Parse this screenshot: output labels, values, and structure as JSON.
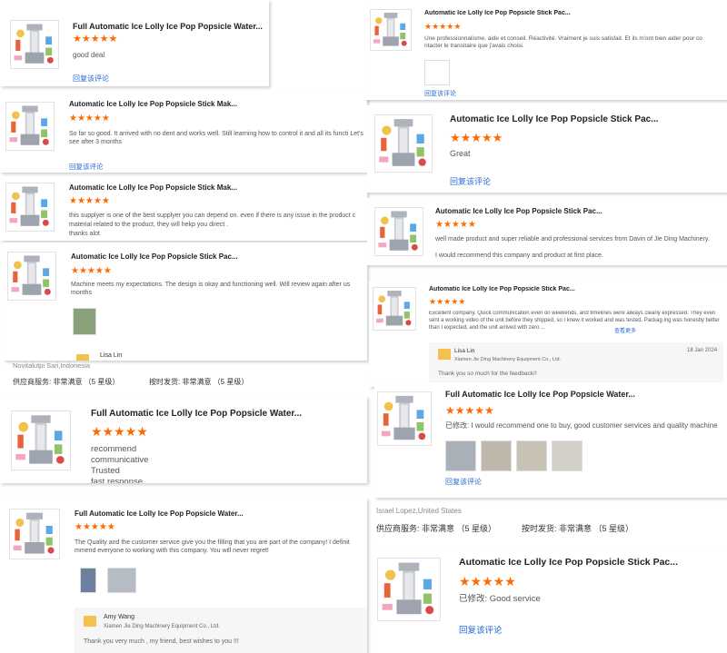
{
  "reviews": [
    {
      "title": "Full Automatic Ice Lolly Ice Pop Popsicle Water...",
      "rating": "★★★★★",
      "text": "good deal",
      "reply_link": "回复该评论"
    },
    {
      "title": "Automatic Ice Lolly Ice Pop Popsicle Stick Mak...",
      "rating": "★★★★★",
      "text": "So far so good. It arrived with no dent and works well. Still learning how to control it and all its functi Let's see after 3 months",
      "reply_link": "回复该评论"
    },
    {
      "title": "Automatic Ice Lolly Ice Pop Popsicle Stick Mak...",
      "rating": "★★★★★",
      "text_lines": [
        "this supplyer is one of the best supplyer you can depend on. even if there is any issue in the product c",
        "material related to the product, they will hekp you direct .",
        "thanks alot"
      ]
    },
    {
      "title": "Automatic Ice Lolly Ice Pop Popsicle Stick Pac...",
      "rating": "★★★★★",
      "text": "Machine meets my expectations. The design is okay and functioning well. Will review again after us months",
      "reply_name": "Lisa Lin",
      "reviewer": "Novitalutpi Sari,Indonesia",
      "supplier_service": "供应商服务: 非常满意 （5 星级）",
      "on_time": "按时发货: 非常满意 （5 星级）"
    },
    {
      "title": "Full Automatic Ice Lolly Ice Pop Popsicle Water...",
      "rating": "★★★★★",
      "text_lines": [
        "recommend",
        "communicative",
        "Trusted",
        "fast response"
      ]
    },
    {
      "title": "Full Automatic Ice Lolly Ice Pop Popsicle Water...",
      "rating": "★★★★★",
      "text": "The Quality and the customer service give you the filling that you are part of the company! I definit mmend everyone to working with this company. You will never regret!",
      "reply_name": "Amy Wang",
      "reply_company": "Xiamen Jie Ding Machinery Equipment Co., Ltd.",
      "reply_text": "Thank you very much , my friend,  best wishes to you !!!"
    },
    {
      "title": "Automatic Ice Lolly Ice Pop Popsicle Stick Pac...",
      "rating": "★★★★★",
      "text": "Une professionnalisme, aide et conseil. Réactivité. Vraiment je suis satisfait. Et ils m'ont bien aider pour co ntacter le transitaire que j'avais choisi.",
      "reply_link": "回复该评论"
    },
    {
      "title": "Automatic Ice Lolly Ice Pop Popsicle Stick Pac...",
      "rating": "★★★★★",
      "text": "Great",
      "reply_link": "回复该评论"
    },
    {
      "title": "Automatic Ice Lolly Ice Pop Popsicle Stick Pac...",
      "rating": "★★★★★",
      "text_lines": [
        "well made product and super reliable and professional services from Davin of Jie Ding Machinery.",
        "I would recommend this company and product at first place."
      ]
    },
    {
      "title": "Automatic Ice Lolly Ice Pop Popsicle Stick Pac...",
      "rating": "★★★★★",
      "text": "Excellent company. Quick communication even on weekends, and timelines were always clearly expressed. They even sent a working video of the unit before they shipped, so I knew it worked and was tested. Packag ing was honestly better than I expected, and the unit arrived with zero ...",
      "more": "查看更多",
      "reply_name": "Lisa Lin",
      "reply_company": "Xiamen Jie Ding Machinery Equipment Co., Ltd.",
      "reply_date": "18 Jan 2024",
      "reply_text": "Thank you so much for the feedback!!"
    },
    {
      "title": "Full Automatic Ice Lolly Ice Pop Popsicle Water...",
      "rating": "★★★★★",
      "text": "已修改: I would recommend one to buy, good customer services and quality machine",
      "reply_link": "回复该评论",
      "reviewer": "Israel Lopez,United States",
      "supplier_service": "供应商服务: 非常满意 （5 星级）",
      "on_time": "按时发货: 非常满意 （5 星级）"
    },
    {
      "title": "Automatic Ice Lolly Ice Pop Popsicle Stick Pac...",
      "rating": "★★★★★",
      "text": "已修改: Good service",
      "reply_link": "回复该评论"
    }
  ],
  "colors": {
    "star": "#ff6a00",
    "link": "#2a6ad8",
    "reply_bg": "#f6f6f6"
  }
}
